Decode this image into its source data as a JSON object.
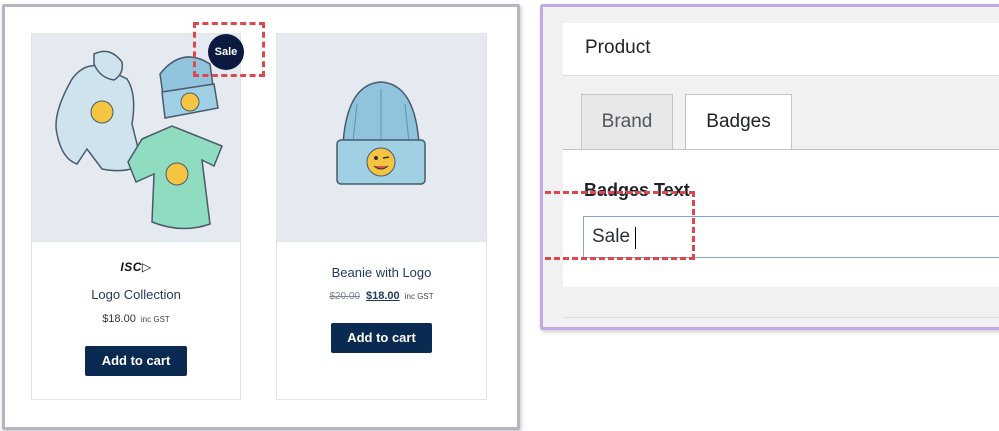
{
  "store": {
    "products": [
      {
        "brand_logo": "ISC▷",
        "title": "Logo Collection",
        "price": "$18.00",
        "tax_note": "inc GST",
        "button": "Add to cart",
        "badge": "Sale"
      },
      {
        "title": "Beanie with Logo",
        "old_price": "$20.00",
        "price": "$18.00",
        "tax_note": "inc GST",
        "button": "Add to cart"
      }
    ]
  },
  "admin": {
    "panel_title": "Product",
    "tabs": [
      {
        "label": "Brand",
        "active": false
      },
      {
        "label": "Badges",
        "active": true
      }
    ],
    "field_label": "Badges Text",
    "field_value": "Sale"
  },
  "colors": {
    "button_bg": "#0b2a52",
    "badge_bg": "#0b1a3e",
    "highlight": "#e0474c",
    "admin_frame": "#c3a8e6"
  }
}
